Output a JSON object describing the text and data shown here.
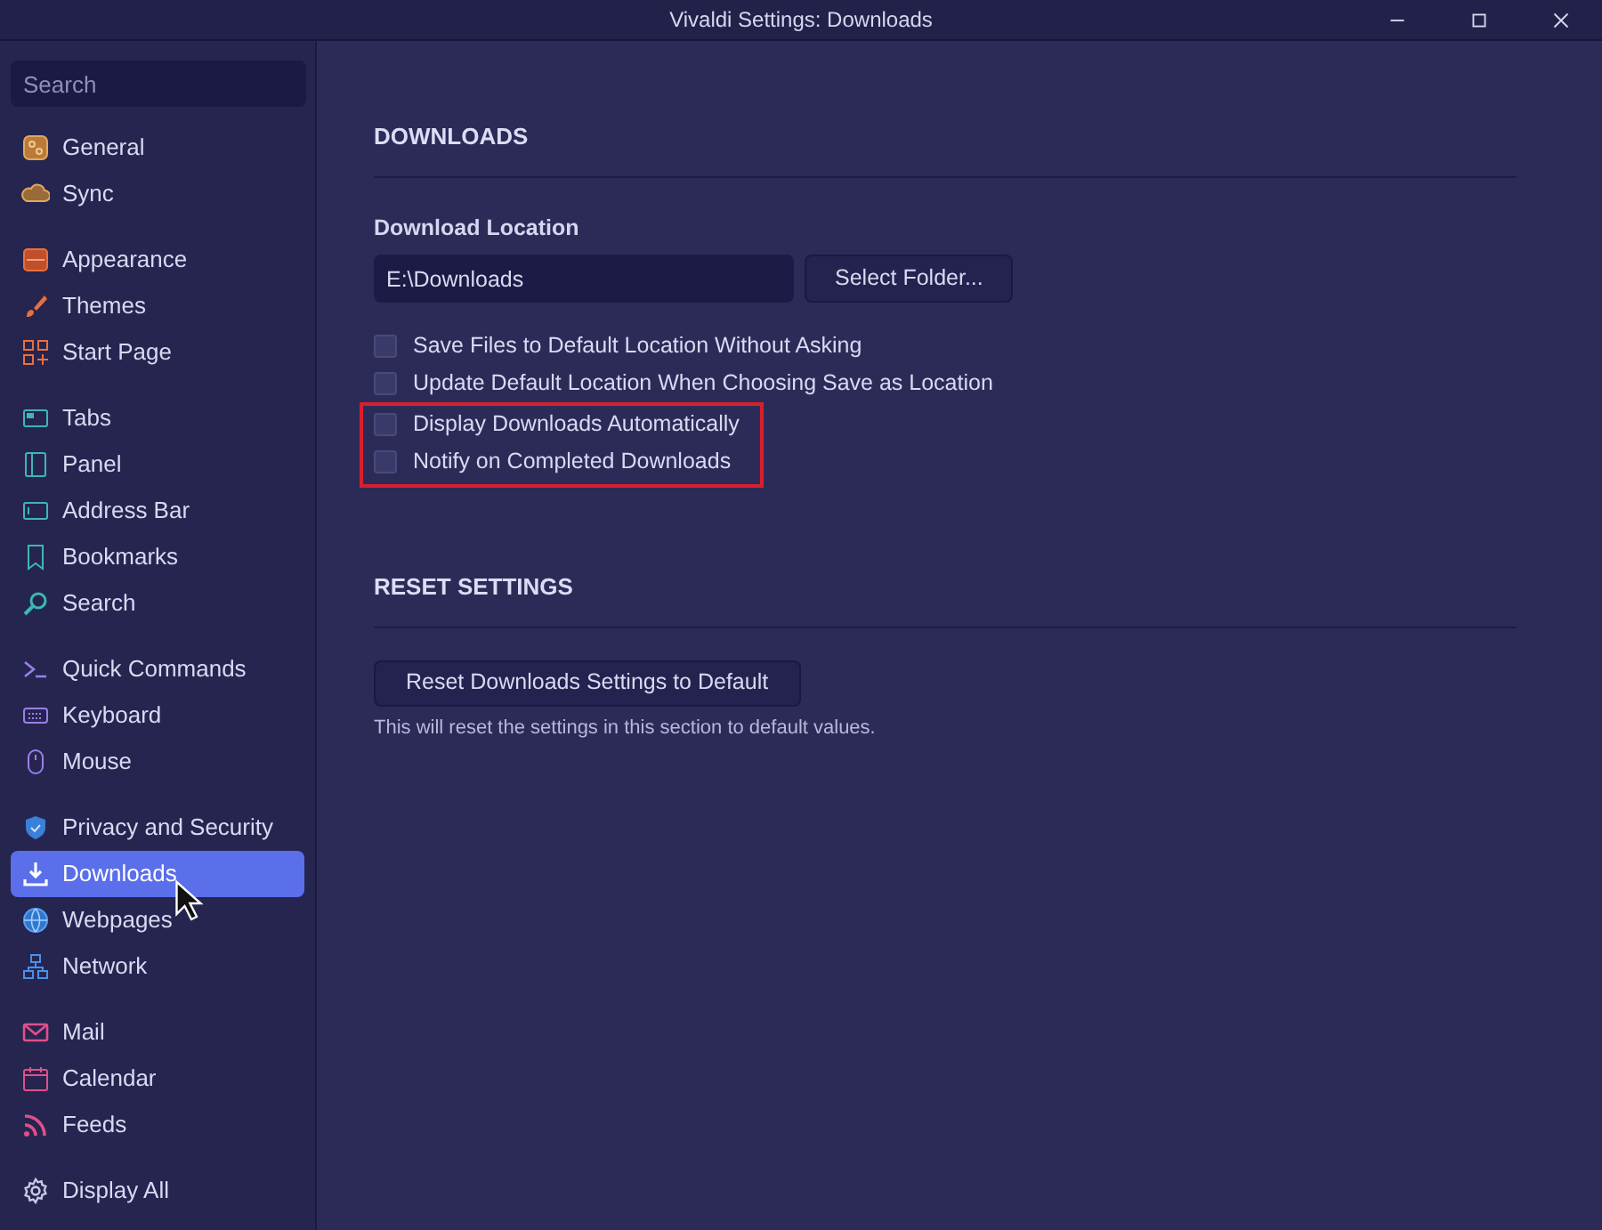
{
  "window": {
    "title": "Vivaldi Settings: Downloads"
  },
  "sidebar": {
    "search": {
      "placeholder": "Search"
    },
    "groups": [
      {
        "items": [
          {
            "label": "General",
            "selected": false
          },
          {
            "label": "Sync",
            "selected": false
          }
        ]
      },
      {
        "items": [
          {
            "label": "Appearance",
            "selected": false
          },
          {
            "label": "Themes",
            "selected": false
          },
          {
            "label": "Start Page",
            "selected": false
          }
        ]
      },
      {
        "items": [
          {
            "label": "Tabs",
            "selected": false
          },
          {
            "label": "Panel",
            "selected": false
          },
          {
            "label": "Address Bar",
            "selected": false
          },
          {
            "label": "Bookmarks",
            "selected": false
          },
          {
            "label": "Search",
            "selected": false
          }
        ]
      },
      {
        "items": [
          {
            "label": "Quick Commands",
            "selected": false
          },
          {
            "label": "Keyboard",
            "selected": false
          },
          {
            "label": "Mouse",
            "selected": false
          }
        ]
      },
      {
        "items": [
          {
            "label": "Privacy and Security",
            "selected": false
          },
          {
            "label": "Downloads",
            "selected": true
          },
          {
            "label": "Webpages",
            "selected": false
          },
          {
            "label": "Network",
            "selected": false
          }
        ]
      },
      {
        "items": [
          {
            "label": "Mail",
            "selected": false
          },
          {
            "label": "Calendar",
            "selected": false
          },
          {
            "label": "Feeds",
            "selected": false
          }
        ]
      },
      {
        "items": [
          {
            "label": "Display All",
            "selected": false
          }
        ]
      }
    ]
  },
  "sections": [
    {
      "title": "DOWNLOADS",
      "location_label": "Download Location",
      "location_value": "E:\\Downloads",
      "folder_button": "Select Folder...",
      "checkboxes": [
        {
          "label": "Save Files to Default Location Without Asking",
          "checked": false,
          "highlighted": false
        },
        {
          "label": "Update Default Location When Choosing Save as Location",
          "checked": false,
          "highlighted": false
        },
        {
          "label": "Display Downloads Automatically",
          "checked": false,
          "highlighted": true
        },
        {
          "label": "Notify on Completed Downloads",
          "checked": false,
          "highlighted": true
        }
      ]
    },
    {
      "title": "RESET SETTINGS",
      "button": "Reset Downloads Settings to Default",
      "note": "This will reset the settings in this section to default values."
    }
  ]
}
